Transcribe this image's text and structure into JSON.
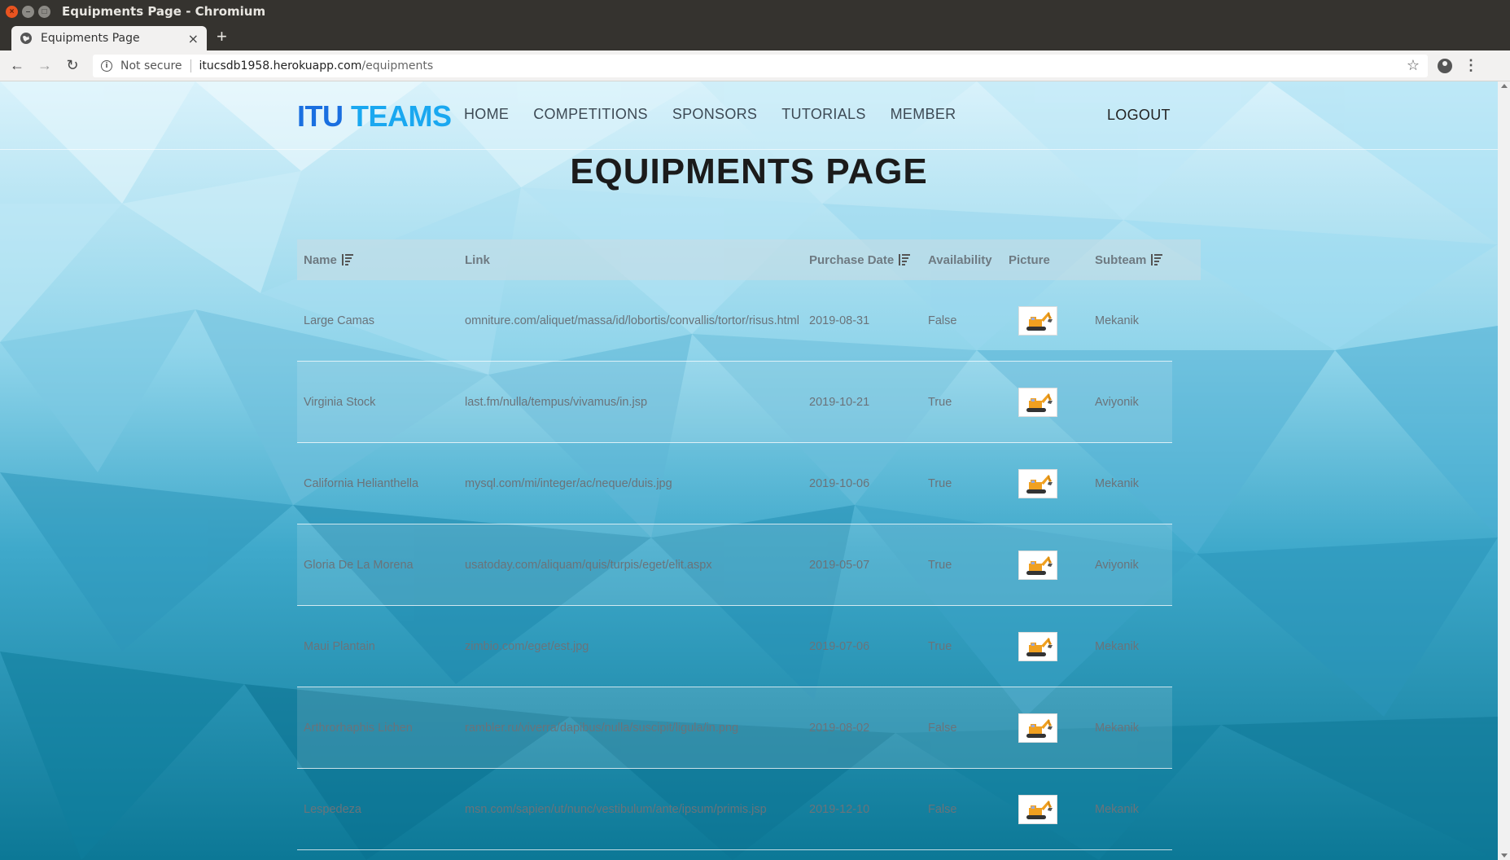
{
  "window": {
    "title": "Equipments Page - Chromium"
  },
  "tab": {
    "title": "Equipments Page",
    "close": "×",
    "new_tab": "+"
  },
  "address_bar": {
    "security_label": "Not secure",
    "host": "itucsdb1958.herokuapp.com",
    "path": "/equipments"
  },
  "site": {
    "brand_part1": "ITU",
    "brand_part2": "TEAMS",
    "nav": [
      "HOME",
      "COMPETITIONS",
      "SPONSORS",
      "TUTORIALS",
      "MEMBER"
    ],
    "logout": "LOGOUT"
  },
  "page": {
    "title": "EQUIPMENTS PAGE"
  },
  "table": {
    "headers": {
      "name": "Name",
      "link": "Link",
      "purchase_date": "Purchase Date",
      "availability": "Availability",
      "picture": "Picture",
      "subteam": "Subteam"
    },
    "rows": [
      {
        "name": "Large Camas",
        "link": "omniture.com/aliquet/massa/id/lobortis/convallis/tortor/risus.html",
        "date": "2019-08-31",
        "availability": "False",
        "subteam": "Mekanik"
      },
      {
        "name": "Virginia Stock",
        "link": "last.fm/nulla/tempus/vivamus/in.jsp",
        "date": "2019-10-21",
        "availability": "True",
        "subteam": "Aviyonik"
      },
      {
        "name": "California Helianthella",
        "link": "mysql.com/mi/integer/ac/neque/duis.jpg",
        "date": "2019-10-06",
        "availability": "True",
        "subteam": "Mekanik"
      },
      {
        "name": "Gloria De La Morena",
        "link": "usatoday.com/aliquam/quis/turpis/eget/elit.aspx",
        "date": "2019-05-07",
        "availability": "True",
        "subteam": "Aviyonik"
      },
      {
        "name": "Maui Plantain",
        "link": "zimbio.com/eget/est.jpg",
        "date": "2019-07-06",
        "availability": "True",
        "subteam": "Mekanik"
      },
      {
        "name": "Arthrorhaphis Lichen",
        "link": "rambler.ru/viverra/dapibus/nulla/suscipit/ligula/in.png",
        "date": "2019-08-02",
        "availability": "False",
        "subteam": "Mekanik"
      },
      {
        "name": "Lespedeza",
        "link": "msn.com/sapien/ut/nunc/vestibulum/ante/ipsum/primis.jsp",
        "date": "2019-12-10",
        "availability": "False",
        "subteam": "Mekanik"
      }
    ]
  },
  "colors": {
    "brand_dark": "#1a6fe0",
    "brand_light": "#1aa8f0",
    "bg_top": "#d7f1fb",
    "bg_bottom": "#0f7f9d"
  }
}
